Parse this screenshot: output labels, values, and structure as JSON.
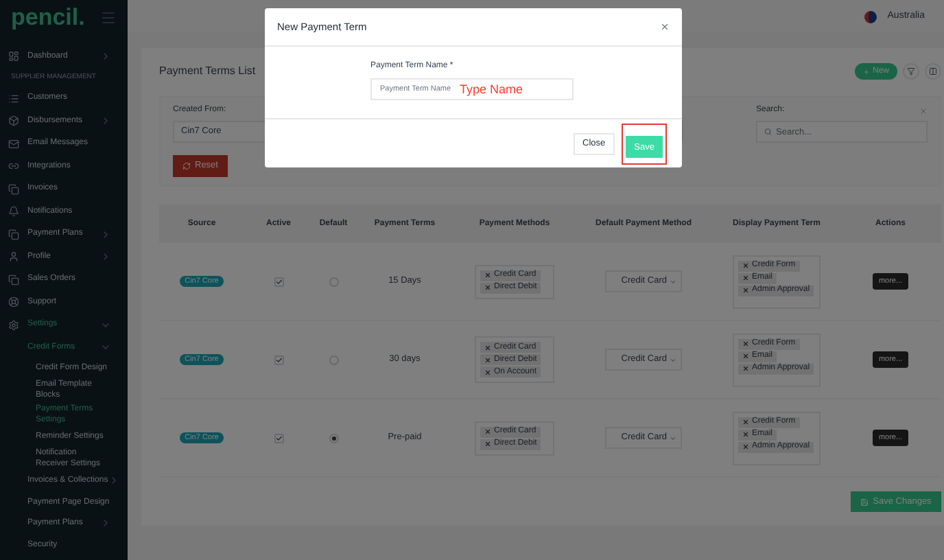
{
  "sidebar": {
    "logo": "pencil.",
    "items": [
      {
        "kind": "item",
        "label": "Dashboard",
        "active": false,
        "expanded": false
      },
      {
        "kind": "heading",
        "label": "SUPPLIER MANAGEMENT"
      },
      {
        "kind": "item",
        "label": "Customers",
        "active": false
      },
      {
        "kind": "item",
        "label": "Disbursements",
        "active": false,
        "expanded": false
      },
      {
        "kind": "item",
        "label": "Email Messages",
        "active": false
      },
      {
        "kind": "item",
        "label": "Integrations",
        "active": false
      },
      {
        "kind": "item",
        "label": "Invoices",
        "active": false
      },
      {
        "kind": "item",
        "label": "Notifications",
        "active": false
      },
      {
        "kind": "item",
        "label": "Payment Plans",
        "active": false,
        "expanded": false
      },
      {
        "kind": "item",
        "label": "Profile",
        "active": false,
        "expanded": false
      },
      {
        "kind": "item",
        "label": "Sales Orders",
        "active": false
      },
      {
        "kind": "item",
        "label": "Support",
        "active": false
      },
      {
        "kind": "item",
        "label": "Settings",
        "active": true,
        "expanded": true,
        "children": [
          {
            "label": "Credit Forms",
            "active": true,
            "expanded": true,
            "children": [
              {
                "label": "Credit Form Design",
                "active": false
              },
              {
                "label": "Email Template Blocks",
                "active": false
              },
              {
                "label": "Payment Terms Settings",
                "active": true
              },
              {
                "label": "Reminder Settings",
                "active": false
              },
              {
                "label": "Notification Receiver Settings",
                "active": false
              }
            ]
          },
          {
            "label": "Invoices & Collections",
            "active": false,
            "expanded": false
          },
          {
            "label": "Payment Page Design",
            "active": false
          },
          {
            "label": "Payment Plans",
            "active": false,
            "expanded": false
          },
          {
            "label": "Security",
            "active": false
          }
        ]
      }
    ]
  },
  "topbar": {
    "region": "Australia"
  },
  "page": {
    "title": "Payment Terms List",
    "new_button": "New",
    "filters": {
      "created_from_label": "Created From:",
      "created_from_value": "Cin7 Core",
      "search_label": "Search:",
      "search_placeholder": "Search...",
      "reset_button": "Reset"
    },
    "table": {
      "columns": [
        "Source",
        "Active",
        "Default",
        "Payment Terms",
        "Payment Methods",
        "Default Payment Method",
        "Display Payment Term",
        "Actions"
      ],
      "rows": [
        {
          "source": "Cin7 Core",
          "active": true,
          "default": false,
          "term": "15 Days",
          "methods": [
            "Credit Card",
            "Direct Debit"
          ],
          "default_method": "Credit Card",
          "display": [
            "Credit Form",
            "Email",
            "Admin Approval"
          ],
          "action": "more..."
        },
        {
          "source": "Cin7 Core",
          "active": true,
          "default": false,
          "term": "30 days",
          "methods": [
            "Credit Card",
            "Direct Debit",
            "On Account"
          ],
          "default_method": "Credit Card",
          "display": [
            "Credit Form",
            "Email",
            "Admin Approval"
          ],
          "action": "more..."
        },
        {
          "source": "Cin7 Core",
          "active": true,
          "default": true,
          "term": "Pre-paid",
          "methods": [
            "Credit Card",
            "Direct Debit"
          ],
          "default_method": "Credit Card",
          "display": [
            "Credit Form",
            "Email",
            "Admin Approval"
          ],
          "action": "more..."
        }
      ]
    },
    "save_changes": "Save Changes"
  },
  "modal": {
    "title": "New Payment Term",
    "field_label": "Payment Term Name *",
    "field_placeholder": "Payment Term Name",
    "annotation": "Type Name",
    "close_button": "Close",
    "save_button": "Save",
    "save_highlighted": true
  }
}
